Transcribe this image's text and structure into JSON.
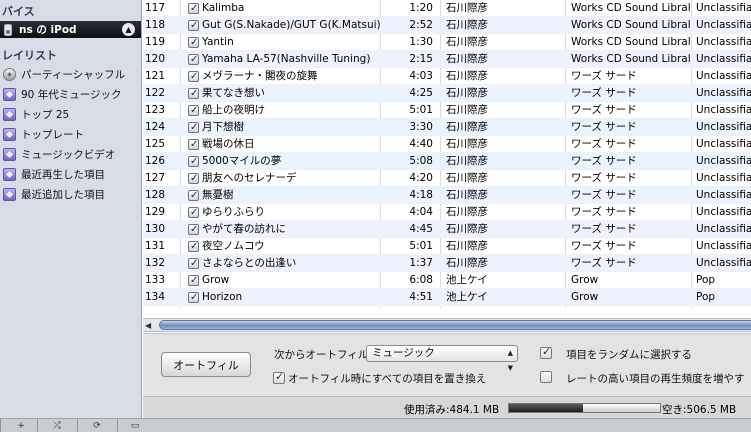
{
  "sidebar": {
    "devices_header": "バイス",
    "device_name": "ns の iPod",
    "playlists_header": "レイリスト",
    "playlists": [
      {
        "label": "パーティーシャッフル",
        "icon": "party-shuffle-icon"
      },
      {
        "label": "90 年代ミュージック",
        "icon": "smart-playlist-icon"
      },
      {
        "label": "トップ 25",
        "icon": "smart-playlist-icon"
      },
      {
        "label": "トップレート",
        "icon": "smart-playlist-icon"
      },
      {
        "label": "ミュージックビデオ",
        "icon": "smart-playlist-icon"
      },
      {
        "label": "最近再生した項目",
        "icon": "smart-playlist-icon"
      },
      {
        "label": "最近追加した項目",
        "icon": "smart-playlist-icon"
      }
    ]
  },
  "tracks": [
    {
      "num": "117",
      "name": "Kalimba",
      "time": "1:20",
      "artist": "石川際彦",
      "album": "Works CD Sound Libraly",
      "genre": "Unclassifiab"
    },
    {
      "num": "118",
      "name": "Gut G(S.Nakade)/GUT G(K.Matsui)...",
      "time": "2:52",
      "artist": "石川際彦",
      "album": "Works CD Sound Libraly",
      "genre": "Unclassifiab"
    },
    {
      "num": "119",
      "name": "Yantin",
      "time": "1:30",
      "artist": "石川際彦",
      "album": "Works CD Sound Libraly",
      "genre": "Unclassifiab"
    },
    {
      "num": "120",
      "name": "Yamaha LA-57(Nashville Tuning)",
      "time": "2:15",
      "artist": "石川際彦",
      "album": "Works CD Sound Libraly",
      "genre": "Unclassifiab"
    },
    {
      "num": "121",
      "name": "メヴラーナ・閣夜の旋舞",
      "time": "4:03",
      "artist": "石川際彦",
      "album": "ワーズ サード",
      "genre": "Unclassifiab"
    },
    {
      "num": "122",
      "name": "果てなき想い",
      "time": "4:25",
      "artist": "石川際彦",
      "album": "ワーズ サード",
      "genre": "Unclassifiab"
    },
    {
      "num": "123",
      "name": "船上の夜明け",
      "time": "5:01",
      "artist": "石川際彦",
      "album": "ワーズ サード",
      "genre": "Unclassifiab"
    },
    {
      "num": "124",
      "name": "月下想樹",
      "time": "3:30",
      "artist": "石川際彦",
      "album": "ワーズ サード",
      "genre": "Unclassifiab"
    },
    {
      "num": "125",
      "name": "戦場の休日",
      "time": "4:40",
      "artist": "石川際彦",
      "album": "ワーズ サード",
      "genre": "Unclassifiab"
    },
    {
      "num": "126",
      "name": "5000マイルの夢",
      "time": "5:08",
      "artist": "石川際彦",
      "album": "ワーズ サード",
      "genre": "Unclassifiab"
    },
    {
      "num": "127",
      "name": "朋友へのセレナーデ",
      "time": "4:20",
      "artist": "石川際彦",
      "album": "ワーズ サード",
      "genre": "Unclassifiab"
    },
    {
      "num": "128",
      "name": "無憂樹",
      "time": "4:18",
      "artist": "石川際彦",
      "album": "ワーズ サード",
      "genre": "Unclassifiab"
    },
    {
      "num": "129",
      "name": "ゆらりふらり",
      "time": "4:04",
      "artist": "石川際彦",
      "album": "ワーズ サード",
      "genre": "Unclassifiab"
    },
    {
      "num": "130",
      "name": "やがて春の訪れに",
      "time": "4:45",
      "artist": "石川際彦",
      "album": "ワーズ サード",
      "genre": "Unclassifiab"
    },
    {
      "num": "131",
      "name": "夜空ノムコウ",
      "time": "5:01",
      "artist": "石川際彦",
      "album": "ワーズ サード",
      "genre": "Unclassifiab"
    },
    {
      "num": "132",
      "name": "さよならとの出逢い",
      "time": "1:37",
      "artist": "石川際彦",
      "album": "ワーズ サード",
      "genre": "Unclassifiab"
    },
    {
      "num": "133",
      "name": "Grow",
      "time": "6:08",
      "artist": "池上ケイ",
      "album": "Grow",
      "genre": "Pop"
    },
    {
      "num": "134",
      "name": "Horizon",
      "time": "4:51",
      "artist": "池上ケイ",
      "album": "Grow",
      "genre": "Pop"
    }
  ],
  "autofill": {
    "button_label": "オートフィル",
    "source_label": "次からオートフィル:",
    "source_selected": "ミュージック",
    "replace_all_label": "オートフィル時にすべての項目を置き換え",
    "replace_all_checked": true,
    "random_label": "項目をランダムに選択する",
    "random_checked": true,
    "rated_label": "レートの高い項目の再生頻度を増やす",
    "rated_checked": false
  },
  "capacity": {
    "used_label": "使用済み:484.1 MB",
    "free_label": "空き:506.5 MB",
    "used_fraction": 0.49
  },
  "colors": {
    "sidebar_bg": "#d6dde6",
    "row_alt": "#edf3fe",
    "panel_bg": "#e3e3e3",
    "device_selected": "#14181e"
  }
}
